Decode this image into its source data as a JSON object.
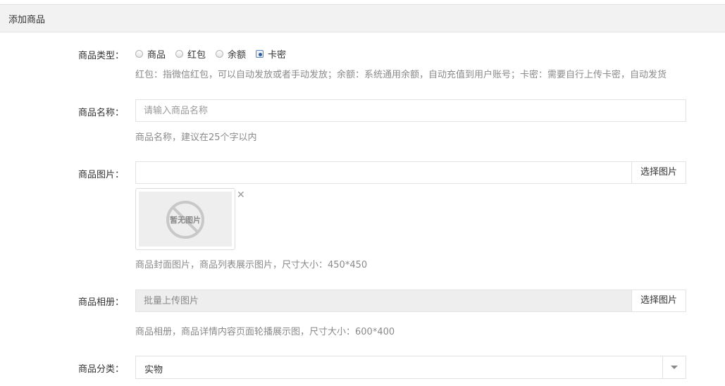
{
  "panel": {
    "title": "添加商品"
  },
  "form": {
    "type": {
      "label": "商品类型：",
      "options": [
        {
          "label": "商品",
          "checked": false
        },
        {
          "label": "红包",
          "checked": false
        },
        {
          "label": "余额",
          "checked": false
        },
        {
          "label": "卡密",
          "checked": true
        }
      ],
      "help": "红包：指微信红包，可以自动发放或者手动发放；余额：系统通用余额，自动充值到用户账号；卡密：需要自行上传卡密，自动发货"
    },
    "name": {
      "label": "商品名称：",
      "placeholder": "请输入商品名称",
      "value": "",
      "help": "商品名称，建议在25个字以内"
    },
    "image": {
      "label": "商品图片：",
      "value": "",
      "button": "选择图片",
      "preview_text": "暂无图片",
      "preview_icon": "no-image-icon",
      "remove_icon": "close-icon",
      "help": "商品封面图片，商品列表展示图片，尺寸大小：450*450"
    },
    "album": {
      "label": "商品相册：",
      "placeholder": "批量上传图片",
      "button": "选择图片",
      "help": "商品相册，商品详情内容页面轮播展示图，尺寸大小：600*400"
    },
    "category": {
      "label": "商品分类：",
      "value": "实物",
      "arrow_icon": "chevron-down-icon"
    }
  },
  "colors": {
    "header_bg": "#f2f2f2",
    "border": "#e2e2e2",
    "help_text": "#8a8a8a",
    "disabled_bg": "#eeeeee",
    "radio_checked": "#2d5b9e"
  }
}
